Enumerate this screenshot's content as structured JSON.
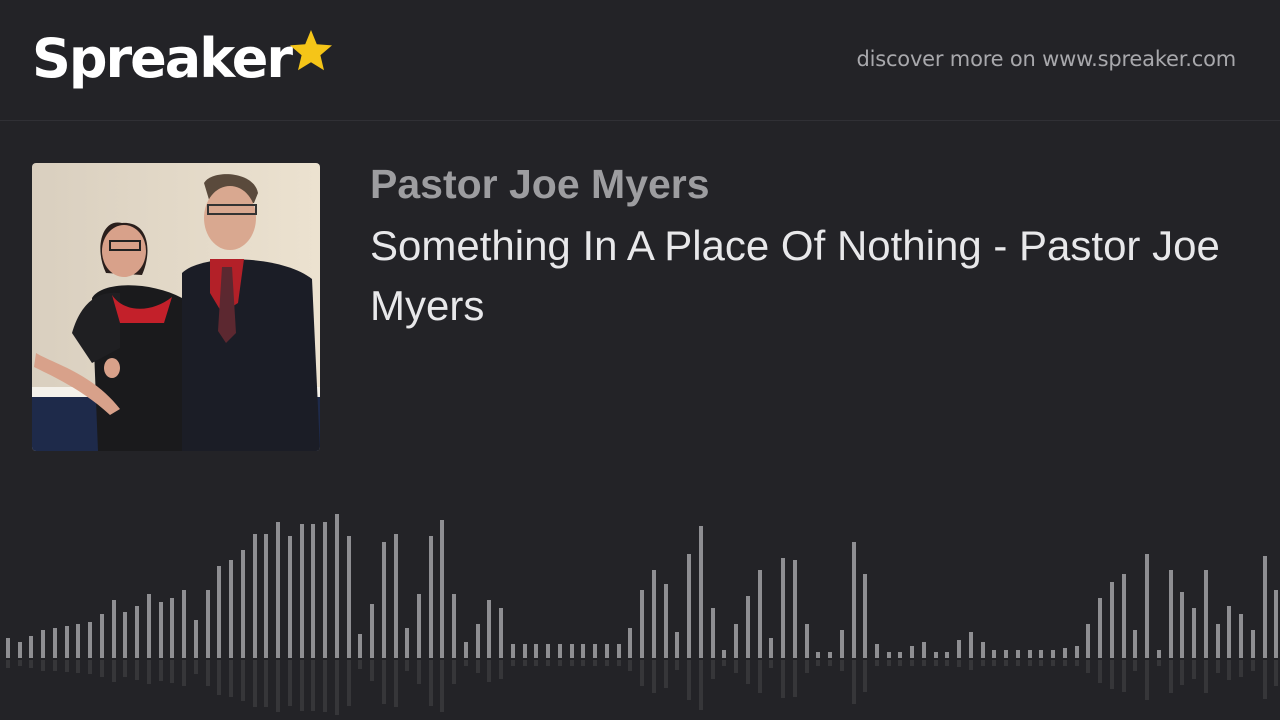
{
  "header": {
    "brand": "Spreaker",
    "discover_text": "discover more on www.spreaker.com"
  },
  "episode": {
    "show_name": "Pastor Joe Myers",
    "title": "Something In A Place Of Nothing - Pastor Joe Myers"
  },
  "colors": {
    "background": "#232327",
    "star": "#f5c518",
    "waveform": "#8e8e92"
  },
  "icons": {
    "logo_star": "star-icon"
  }
}
